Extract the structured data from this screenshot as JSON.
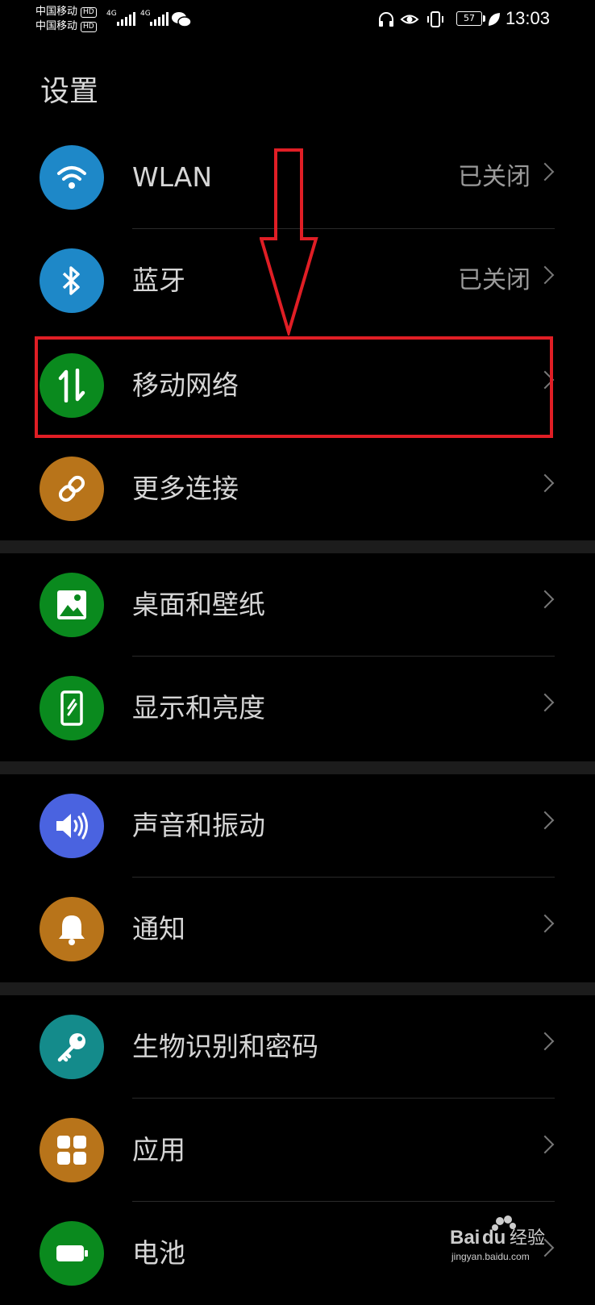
{
  "statusbar": {
    "carrier1": "中国移动",
    "carrier2": "中国移动",
    "hd": "HD",
    "network": "4G",
    "battery": "57",
    "time": "13:03"
  },
  "page": {
    "title": "设置"
  },
  "items": [
    {
      "label": "WLAN",
      "status": "已关闭",
      "icon": "wifi-icon",
      "color": "#1e88c8"
    },
    {
      "label": "蓝牙",
      "status": "已关闭",
      "icon": "bluetooth-icon",
      "color": "#1e88c8"
    },
    {
      "label": "移动网络",
      "status": "",
      "icon": "mobile-data-icon",
      "color": "#0a8a1e"
    },
    {
      "label": "更多连接",
      "status": "",
      "icon": "link-icon",
      "color": "#b8741a"
    },
    {
      "label": "桌面和壁纸",
      "status": "",
      "icon": "image-icon",
      "color": "#0a8a1e"
    },
    {
      "label": "显示和亮度",
      "status": "",
      "icon": "phone-display-icon",
      "color": "#0a8a1e"
    },
    {
      "label": "声音和振动",
      "status": "",
      "icon": "speaker-icon",
      "color": "#4a63e0"
    },
    {
      "label": "通知",
      "status": "",
      "icon": "bell-icon",
      "color": "#b8741a"
    },
    {
      "label": "生物识别和密码",
      "status": "",
      "icon": "key-icon",
      "color": "#148b8b"
    },
    {
      "label": "应用",
      "status": "",
      "icon": "apps-grid-icon",
      "color": "#b8741a"
    },
    {
      "label": "电池",
      "status": "",
      "icon": "battery-icon",
      "color": "#0a8a1e"
    }
  ],
  "watermark": {
    "text": "Baidu经验",
    "url": "jingyan.baidu.com"
  }
}
